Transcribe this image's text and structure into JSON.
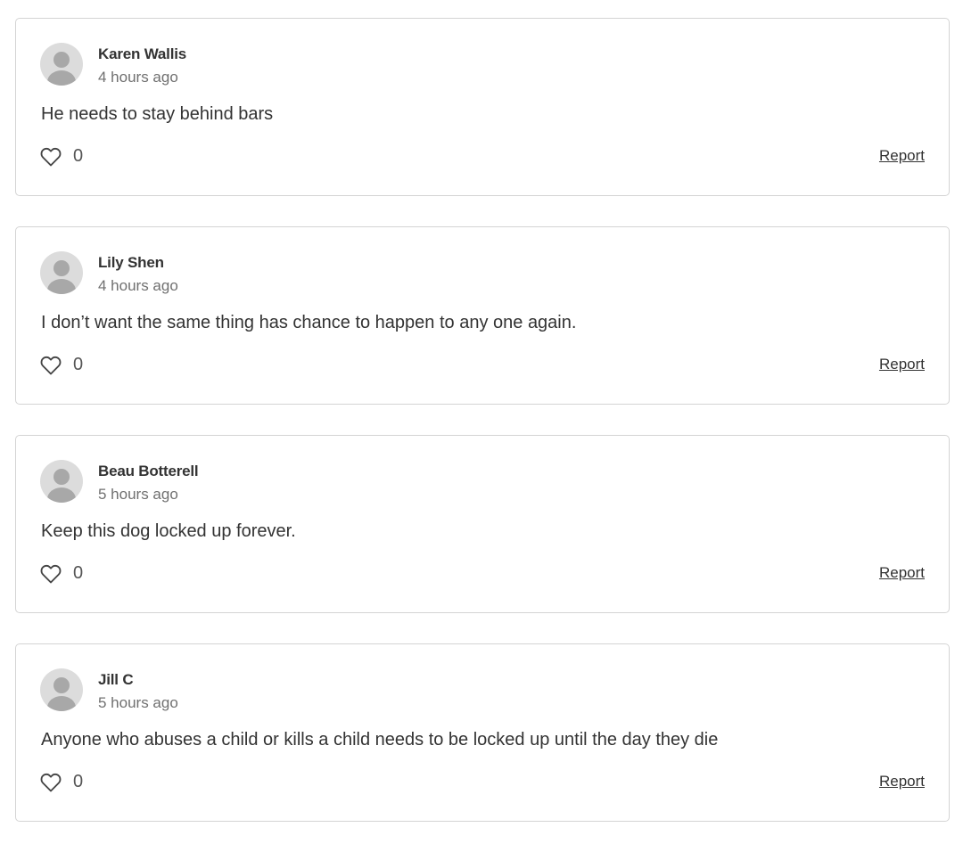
{
  "comments": [
    {
      "author": "Karen Wallis",
      "time": "4 hours ago",
      "text": "He needs to stay behind bars",
      "likes": "0",
      "report_label": "Report"
    },
    {
      "author": "Lily Shen",
      "time": "4 hours ago",
      "text": "I don’t want the same thing has chance to happen to any one again.",
      "likes": "0",
      "report_label": "Report"
    },
    {
      "author": "Beau Botterell",
      "time": "5 hours ago",
      "text": "Keep this dog locked up forever.",
      "likes": "0",
      "report_label": "Report"
    },
    {
      "author": "Jill C",
      "time": "5 hours ago",
      "text": "Anyone who abuses a child or kills a child needs to be locked up until the day they die",
      "likes": "0",
      "report_label": "Report"
    }
  ],
  "icons": {
    "avatar": "default-avatar-icon",
    "like": "heart-outline-icon"
  },
  "colors": {
    "card_border": "#d4d4d4",
    "avatar_bg": "#dcdcdc",
    "avatar_figure": "#a8a8a8",
    "text": "#333333",
    "muted": "#707070"
  }
}
